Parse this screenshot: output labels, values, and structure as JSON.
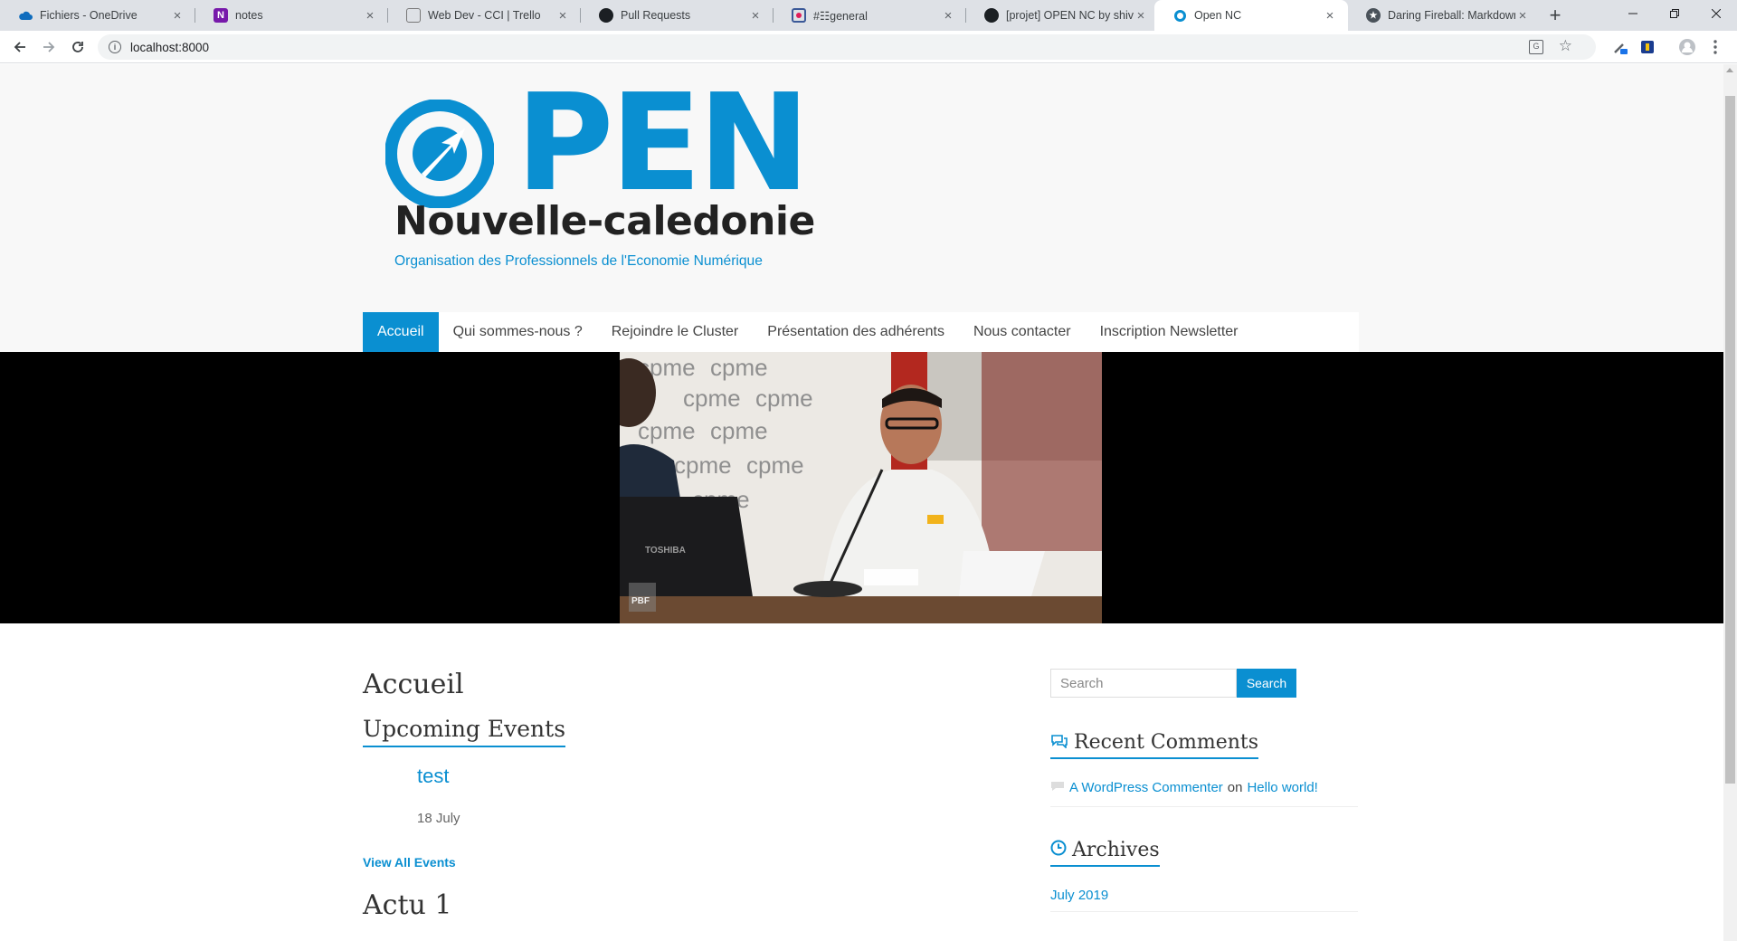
{
  "browser": {
    "tabs": [
      {
        "title": "Fichiers - OneDrive",
        "icon": "onedrive-icon"
      },
      {
        "title": "notes",
        "icon": "onenote-icon"
      },
      {
        "title": "Web Dev - CCI | Trello",
        "icon": "trello-icon"
      },
      {
        "title": "Pull Requests",
        "icon": "github-icon"
      },
      {
        "title": "#☷general",
        "icon": "slack-icon"
      },
      {
        "title": "[projet] OPEN NC by shivay",
        "icon": "github-icon"
      },
      {
        "title": "Open NC",
        "icon": "site-icon"
      },
      {
        "title": "Daring Fireball: Markdown",
        "icon": "star-icon"
      }
    ],
    "active_tab": 6,
    "url": "localhost:8000"
  },
  "site": {
    "logo": {
      "word": "PEN",
      "subtitle": "Nouvelle-caledonie",
      "tagline": "Organisation des Professionnels de l'Economie Numérique"
    },
    "nav": [
      {
        "label": "Accueil",
        "active": true
      },
      {
        "label": "Qui sommes-nous ?",
        "active": false
      },
      {
        "label": "Rejoindre le Cluster",
        "active": false
      },
      {
        "label": "Présentation des adhérents",
        "active": false
      },
      {
        "label": "Nous contacter",
        "active": false
      },
      {
        "label": "Inscription Newsletter",
        "active": false
      }
    ],
    "hero_logo_text": "cpme",
    "hero_laptop_brand": "TOSHIBA",
    "hero_watermark": "PBF"
  },
  "main": {
    "page_title": "Accueil",
    "events_heading": "Upcoming Events",
    "event": {
      "title": "test",
      "date": "18 July"
    },
    "view_all": "View All Events",
    "post_title": "Actu 1"
  },
  "sidebar": {
    "search_placeholder": "Search",
    "search_button": "Search",
    "recent_comments_title": "Recent Comments",
    "comment": {
      "author": "A WordPress Commenter",
      "on": "on",
      "post": "Hello world!"
    },
    "archives_title": "Archives",
    "archive_item": "July 2019"
  },
  "colors": {
    "accent": "#0a8fd1",
    "header_bg": "#f8f8f8",
    "hero_bg": "#000000"
  }
}
